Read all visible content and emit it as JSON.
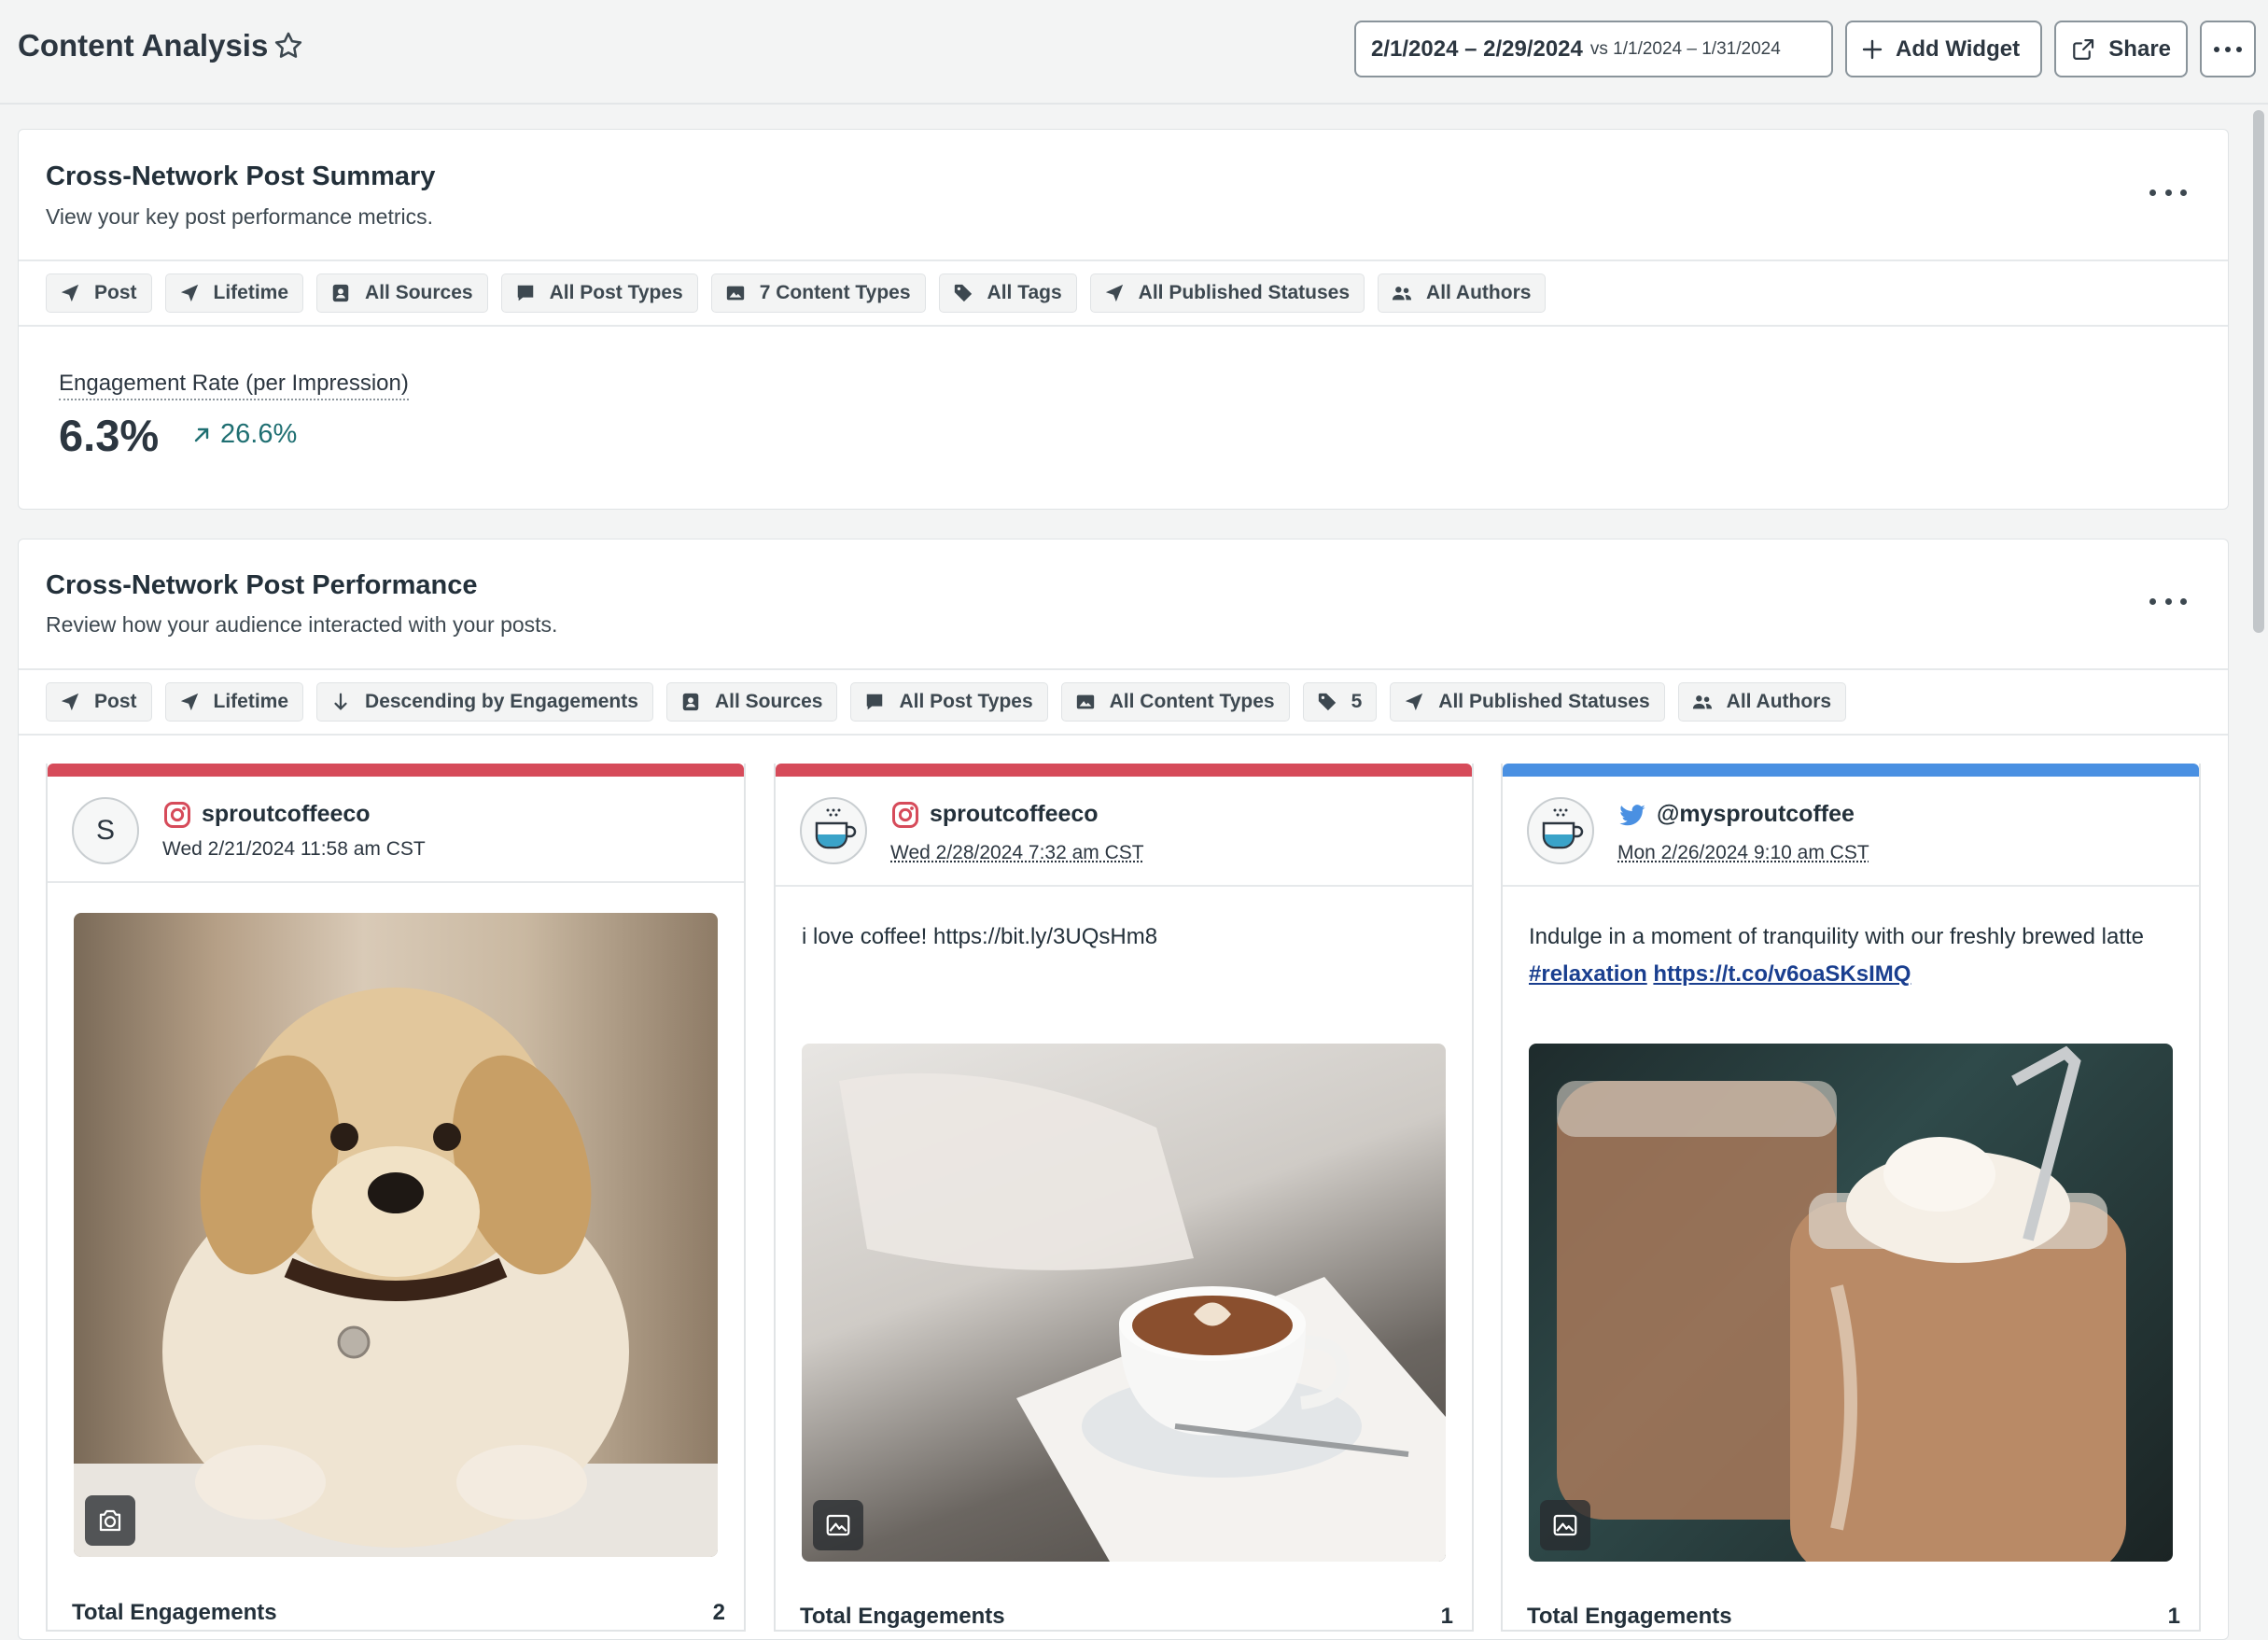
{
  "header": {
    "title": "Content Analysis",
    "date_range": "2/1/2024 – 2/29/2024",
    "compare_range": "vs 1/1/2024 – 1/31/2024",
    "add_widget_label": "Add Widget",
    "share_label": "Share"
  },
  "summary": {
    "title": "Cross-Network Post Summary",
    "subtitle": "View your key post performance metrics.",
    "filters": [
      "Post",
      "Lifetime",
      "All Sources",
      "All Post Types",
      "7 Content Types",
      "All Tags",
      "All Published Statuses",
      "All Authors"
    ],
    "metric_label": "Engagement Rate (per Impression)",
    "metric_value": "6.3%",
    "metric_change": "26.6%"
  },
  "performance": {
    "title": "Cross-Network Post Performance",
    "subtitle": "Review how your audience interacted with your posts.",
    "filters": [
      "Post",
      "Lifetime",
      "Descending by Engagements",
      "All Sources",
      "All Post Types",
      "All Content Types",
      "5",
      "All Published Statuses",
      "All Authors"
    ],
    "posts": [
      {
        "network": "instagram",
        "bar_color": "#d64b5a",
        "avatar_letter": "S",
        "handle": "sproutcoffeeco",
        "date": "Wed 2/21/2024 11:58 am CST",
        "text": "",
        "media_type": "camera-icon",
        "total_label": "Total Engagements",
        "total_value": "2"
      },
      {
        "network": "instagram",
        "bar_color": "#d64b5a",
        "avatar_letter": "",
        "handle": "sproutcoffeeco",
        "date": "Wed 2/28/2024 7:32 am CST",
        "text": "i love coffee! https://bit.ly/3UQsHm8",
        "media_type": "image-icon",
        "total_label": "Total Engagements",
        "total_value": "1"
      },
      {
        "network": "twitter",
        "bar_color": "#4a90e2",
        "avatar_letter": "",
        "handle": "@mysproutcoffee",
        "date": "Mon 2/26/2024 9:10 am CST",
        "text": "Indulge in a moment of tranquility with our freshly brewed latte",
        "hashtag": "#relaxation",
        "link": "https://t.co/v6oaSKsIMQ",
        "media_type": "image-icon",
        "total_label": "Total Engagements",
        "total_value": "1"
      }
    ]
  }
}
